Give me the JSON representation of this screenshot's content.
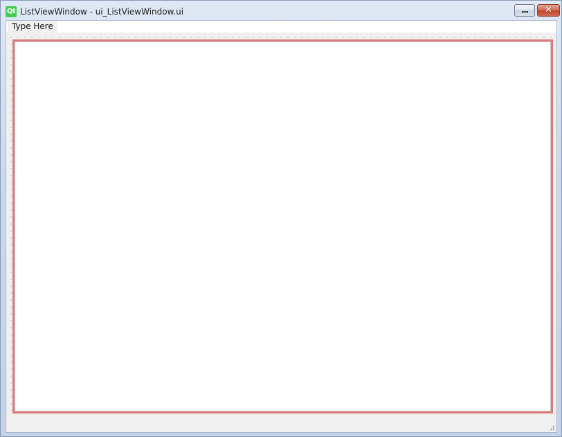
{
  "window": {
    "title": "ListViewWindow - ui_ListViewWindow.ui",
    "app_logo_text": "Qt",
    "minimize_icon": "minimize-icon",
    "close_icon": "close-icon",
    "close_glyph": "✕"
  },
  "menubar": {
    "items": [
      {
        "label": "Type Here"
      }
    ]
  },
  "colors": {
    "qt_green": "#41cd52",
    "selection_border": "#e07a7a",
    "close_red": "#c2452c"
  }
}
